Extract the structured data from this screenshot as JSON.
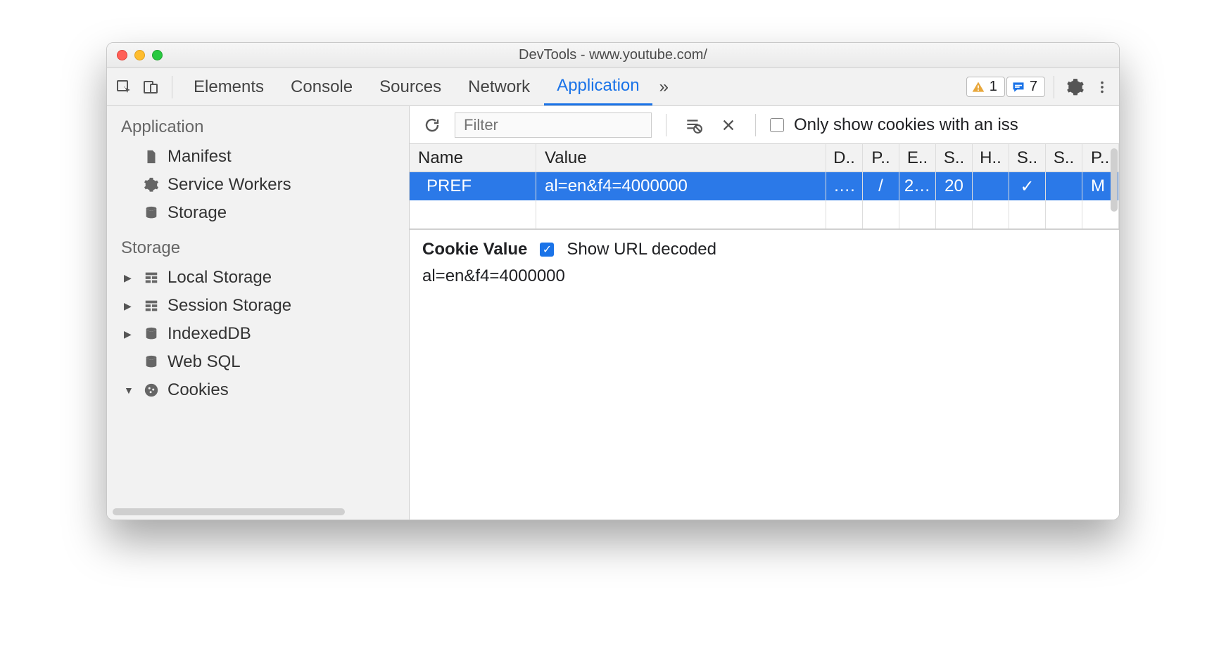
{
  "window": {
    "title": "DevTools - www.youtube.com/"
  },
  "toolbar": {
    "tabs": [
      "Elements",
      "Console",
      "Sources",
      "Network",
      "Application"
    ],
    "active_tab": "Application",
    "more": "»",
    "warn_count": "1",
    "msg_count": "7"
  },
  "sidebar": {
    "section_application": "Application",
    "app_items": [
      {
        "label": "Manifest",
        "icon": "file"
      },
      {
        "label": "Service Workers",
        "icon": "gear"
      },
      {
        "label": "Storage",
        "icon": "db"
      }
    ],
    "section_storage": "Storage",
    "storage_items": [
      {
        "label": "Local Storage",
        "icon": "table",
        "expandable": true,
        "open": false
      },
      {
        "label": "Session Storage",
        "icon": "table",
        "expandable": true,
        "open": false
      },
      {
        "label": "IndexedDB",
        "icon": "db",
        "expandable": true,
        "open": false
      },
      {
        "label": "Web SQL",
        "icon": "db",
        "expandable": false
      },
      {
        "label": "Cookies",
        "icon": "cookie",
        "expandable": true,
        "open": true
      }
    ]
  },
  "filterbar": {
    "placeholder": "Filter",
    "checkbox_label": "Only show cookies with an iss"
  },
  "table": {
    "headers": [
      "Name",
      "Value",
      "D..",
      "P..",
      "E..",
      "S..",
      "H..",
      "S..",
      "S..",
      "P.."
    ],
    "row": {
      "name": "PREF",
      "value": "al=en&f4=4000000",
      "domain": "….",
      "path": "/",
      "expires": "2…",
      "size": "20",
      "http": "",
      "secure": "✓",
      "samesite": "",
      "priority": "M"
    }
  },
  "detail": {
    "heading": "Cookie Value",
    "checkbox_label": "Show URL decoded",
    "checkbox_on": true,
    "value": "al=en&f4=4000000"
  }
}
